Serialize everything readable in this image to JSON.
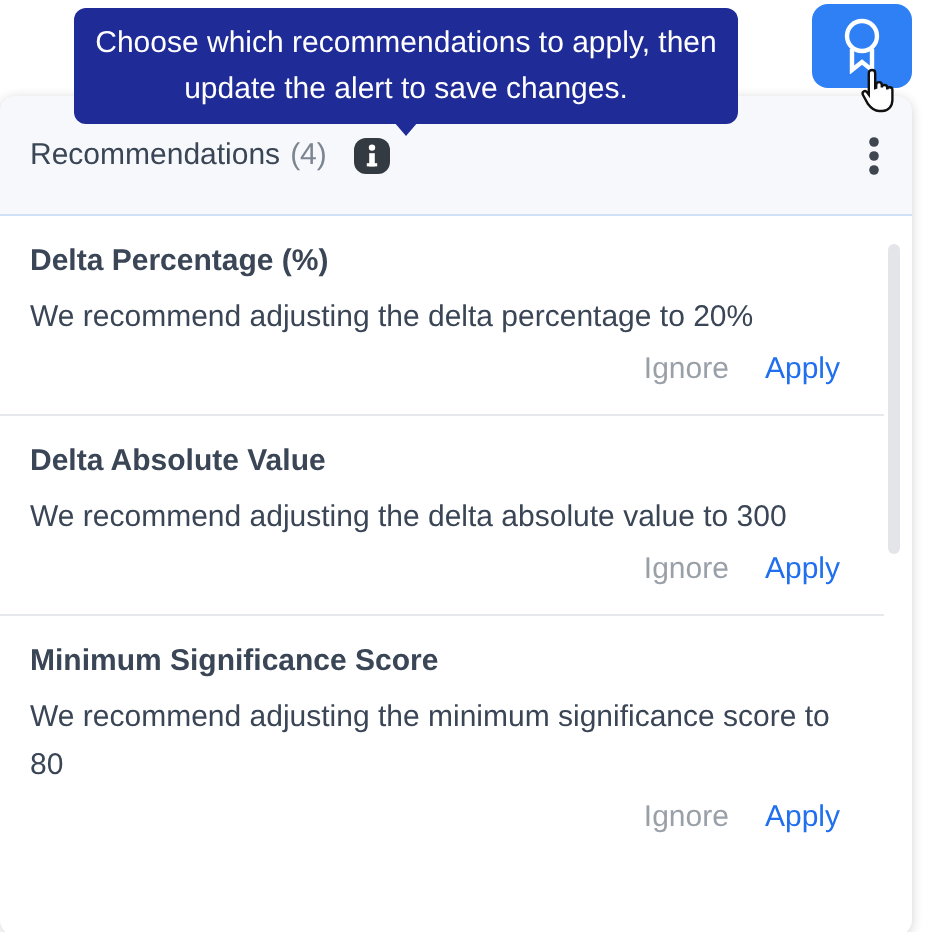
{
  "tooltip": {
    "text": "Choose which recommendations to apply, then update the alert to save changes."
  },
  "panel": {
    "title": "Recommendations",
    "count": "(4)"
  },
  "recommendations": [
    {
      "title": "Delta Percentage (%)",
      "description": "We recommend adjusting the delta percentage to 20%",
      "actions": [
        "Ignore",
        "Apply"
      ]
    },
    {
      "title": "Delta Absolute Value",
      "description": "We recommend adjusting the delta absolute value to 300",
      "actions": [
        "Ignore",
        "Apply"
      ]
    },
    {
      "title": "Minimum Significance Score",
      "description": "We recommend adjusting the minimum significance score to 80",
      "actions": [
        "Ignore",
        "Apply"
      ]
    }
  ]
}
